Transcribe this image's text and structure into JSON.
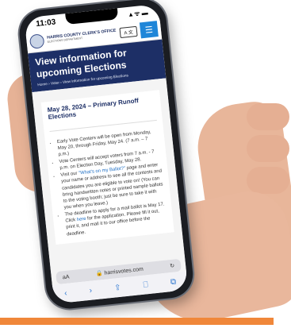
{
  "device": {
    "time": "11:03",
    "status_icons": "▴ ᯤ ▬"
  },
  "header": {
    "office_name": "HARRIS COUNTY CLERK'S OFFICE",
    "department": "ELECTIONS DEPARTMENT",
    "translate_label": "A 文",
    "menu_icon_char": "☰"
  },
  "hero": {
    "title": "View information for upcoming Elections",
    "breadcrumb": "Home  ›  Voter  ›  View information for upcoming Elections"
  },
  "election": {
    "heading": "May 28, 2024 – Primary Runoff Elections",
    "items": [
      {
        "text": "Early Vote Centers will be open from Monday, May 20, through Friday, May 24. (7 a.m. – 7 p.m.)"
      },
      {
        "text": "Vote Centers will accept voters from 7 a.m. - 7 p.m. on Election Day, Tuesday, May 28."
      },
      {
        "prefix": "Visit our ",
        "link": "\"What's on my Ballot?\"",
        "suffix": " page and enter your name or address to see all the contests and candidates you are eligible to vote on! (You can bring handwritten notes or printed sample ballots to the voting booth; just be sure to take it with you when you leave.)"
      },
      {
        "prefix": "The deadline to apply for a mail ballot is May 17. Click ",
        "link": "here",
        "suffix": " for the application. Please fill it out, print it, and mail it to our office before the deadline."
      }
    ]
  },
  "browser": {
    "text_size": "aA",
    "lock_icon": "🔒",
    "url": "harrisvotes.com",
    "reload_icon": "↻",
    "toolbar": {
      "back": "‹",
      "forward": "›",
      "share": "⇪",
      "bookmarks": "⎕",
      "tabs": "⧉"
    }
  },
  "colors": {
    "hero_bg": "#1d2f66",
    "menu_bg": "#1f86d8",
    "link": "#1f6fc4",
    "orange_bar": "#f0873a"
  }
}
